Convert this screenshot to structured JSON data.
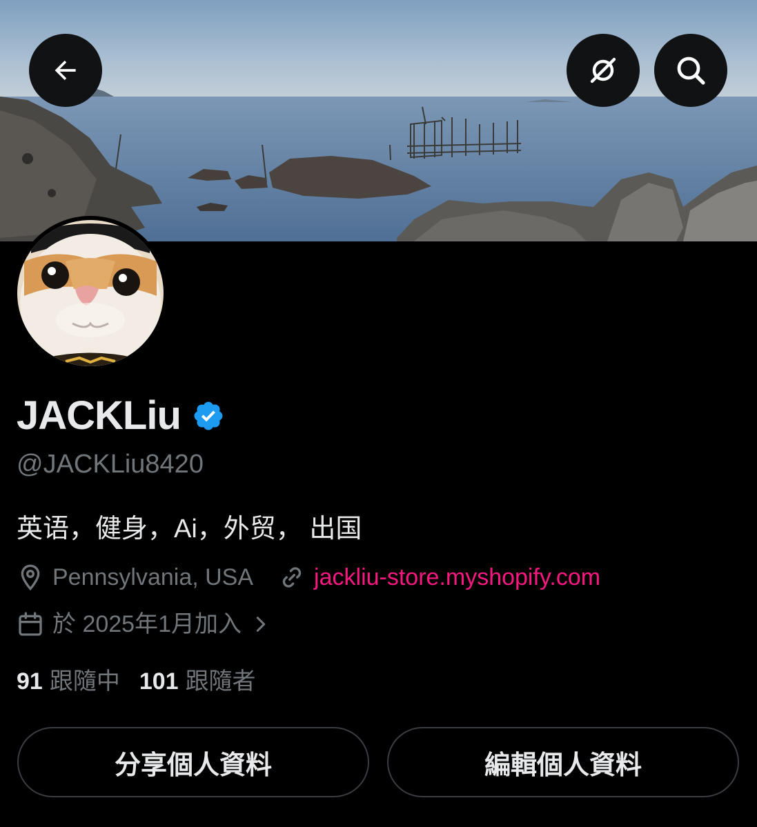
{
  "header": {
    "icons": {
      "back": "back-arrow-icon",
      "grok": "grok-icon",
      "search": "search-icon"
    }
  },
  "profile": {
    "display_name": "JACKLiu",
    "handle": "@JACKLiu8420",
    "bio": "英语，健身，Ai，外贸， 出国",
    "location": "Pennsylvania, USA",
    "website": "jackliu-store.myshopify.com",
    "joined": "於 2025年1月加入",
    "following_count": "91",
    "following_label": "跟隨中",
    "followers_count": "101",
    "followers_label": "跟隨者"
  },
  "actions": {
    "share_label": "分享個人資料",
    "edit_label": "編輯個人資料"
  },
  "colors": {
    "background": "#000000",
    "verified_badge": "#1d9bf0",
    "link": "#f91880",
    "secondary_text": "#71767b"
  }
}
